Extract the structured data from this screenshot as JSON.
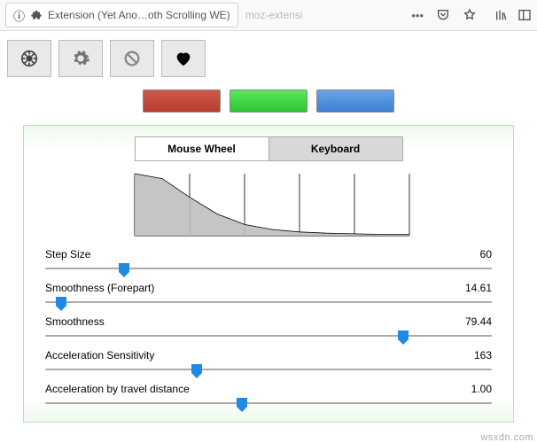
{
  "chrome": {
    "tab_title": "Extension (Yet Ano…oth Scrolling WE)",
    "url_hint": "moz-extensi",
    "info_icon": "info",
    "ext_icon": "puzzle"
  },
  "toolbar": {
    "buttons": [
      "wheel-icon",
      "gear-icon",
      "forbidden-icon",
      "heart-icon"
    ]
  },
  "color_tiles": [
    "#b53d2f",
    "#2fc531",
    "#3b7fd6"
  ],
  "tabs": {
    "items": [
      {
        "label": "Mouse Wheel",
        "active": true
      },
      {
        "label": "Keyboard",
        "active": false
      }
    ]
  },
  "chart_data": {
    "type": "area",
    "x": [
      0,
      0.1,
      0.2,
      0.3,
      0.4,
      0.5,
      0.6,
      0.7,
      0.8,
      0.9,
      1.0
    ],
    "values": [
      1.0,
      0.92,
      0.62,
      0.35,
      0.18,
      0.1,
      0.06,
      0.04,
      0.03,
      0.02,
      0.02
    ],
    "ticks_x": [
      0,
      0.2,
      0.4,
      0.6,
      0.8,
      1.0
    ],
    "xlabel": "",
    "ylabel": "",
    "title": ""
  },
  "sliders": [
    {
      "label": "Step Size",
      "value": "60",
      "pos": 0.18
    },
    {
      "label": "Smoothness (Forepart)",
      "value": "14.61",
      "pos": 0.04
    },
    {
      "label": "Smoothness",
      "value": "79.44",
      "pos": 0.8
    },
    {
      "label": "Acceleration Sensitivity",
      "value": "163",
      "pos": 0.34
    },
    {
      "label": "Acceleration by travel distance",
      "value": "1.00",
      "pos": 0.44
    }
  ],
  "watermark": "wsxdn.com"
}
